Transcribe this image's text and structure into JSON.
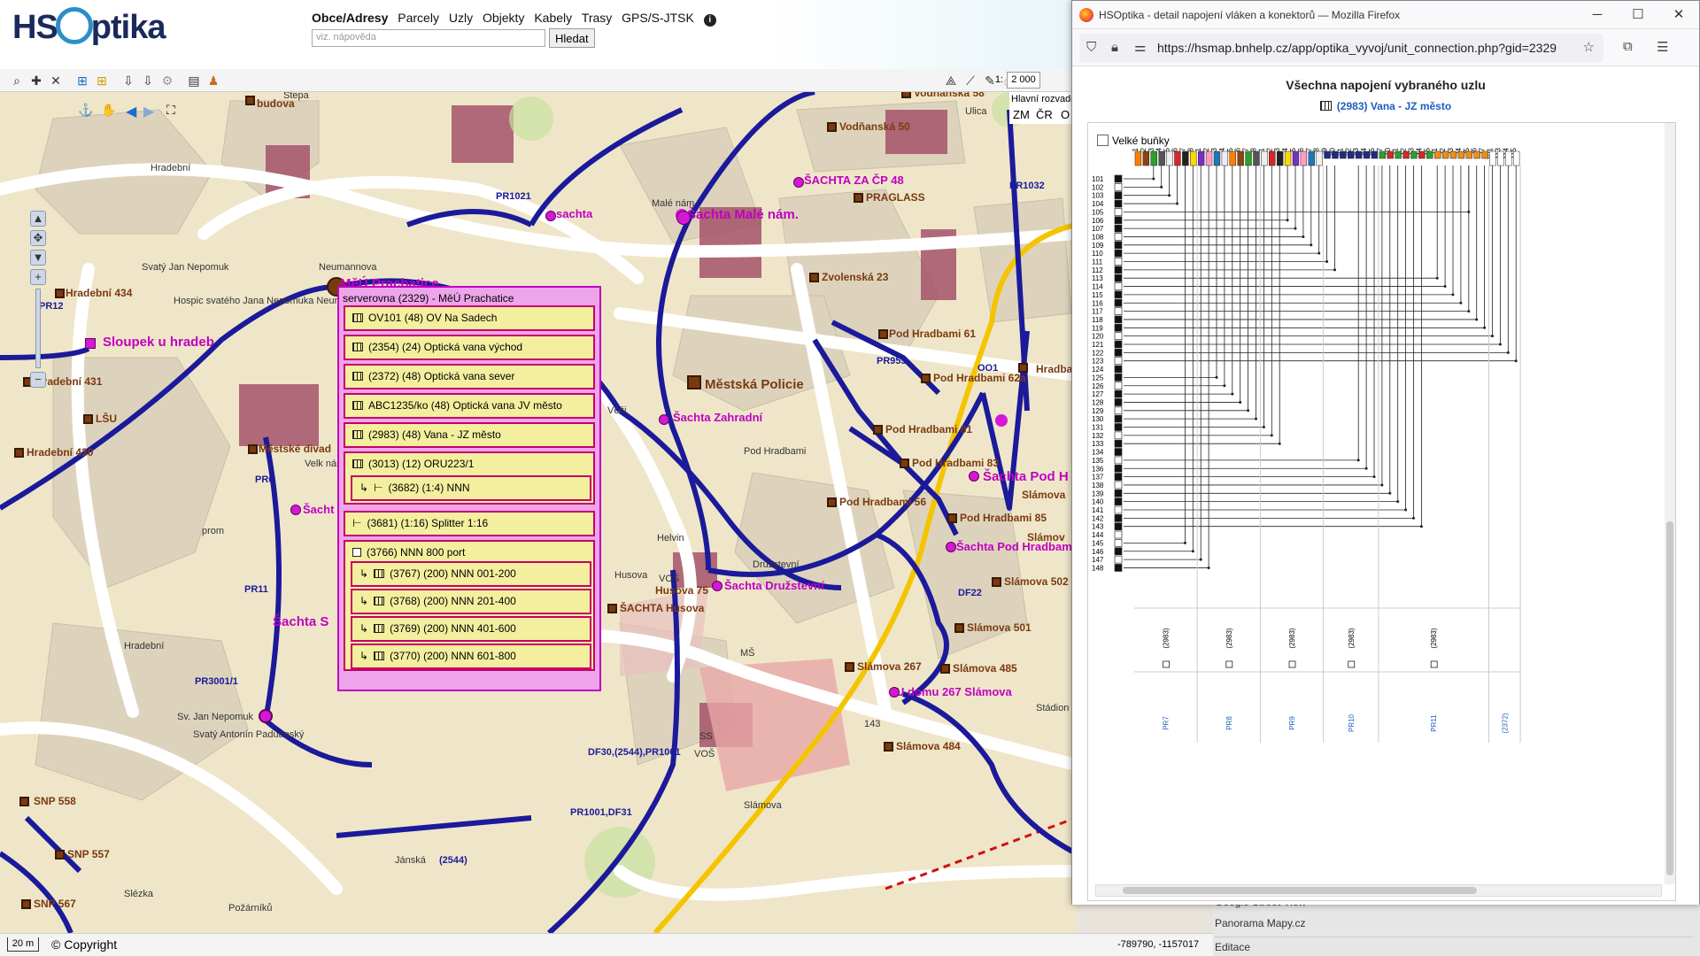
{
  "app": {
    "logo_text_left": "HS",
    "logo_text_right": "ptika",
    "nav": [
      "Obce/Adresy",
      "Parcely",
      "Uzly",
      "Objekty",
      "Kabely",
      "Trasy",
      "GPS/S-JTSK"
    ],
    "search_placeholder": "viz. nápověda",
    "search_button": "Hledat",
    "scale_prefix": "1:",
    "scale_value": "2 000",
    "layer_buttons": [
      "Hlavní rozvaděč",
      "ZM",
      "ČR",
      "O"
    ]
  },
  "map": {
    "labels_brown": [
      "budova",
      "Hradební 434",
      "Hradební 431",
      "Hradební 430",
      "LŠU",
      "Městské divad",
      "Vodňanská 58",
      "Vodňanská 50",
      "PRAGLASS",
      "Zvolenská 23",
      "Pod Hradbami 61",
      "Pod Hradbami 62a",
      "Pod Hradbami 81",
      "Pod Hradbami 83",
      "Pod Hradbami 56",
      "Pod Hradbami 85",
      "Slámova",
      "Slámova 502",
      "Slámova 501",
      "Slámova 267",
      "Slámova 485",
      "Slámova 484",
      "Městská Policie",
      "Hradba",
      "SNP 558",
      "SNP 557",
      "SNP 567",
      "Husova 75",
      "ŠACHTA Husova",
      "Slámov"
    ],
    "labels_pink": [
      "sachta",
      "Šachta Malé nám.",
      "ŠACHTA ZA ČP 48",
      "Sloupek u hradeb",
      "MěÚ Prachatice",
      "Šachta Zahradní",
      "Šachta Pod H",
      "Šachta Pod Hradbam",
      "Šachta Družstevní",
      "U domu 267 Slámova",
      "Šachta S",
      "Šacht"
    ],
    "labels_route": [
      "PR1021",
      "PR1032",
      "PR955",
      "OO1",
      "PR12",
      "PR6",
      "PR11",
      "PR3001/1",
      "DF22",
      "DF30,(2544),PR1001",
      "PR1001,DF31",
      "(2544)",
      "143"
    ],
    "labels_street": [
      "Hradební",
      "Stepa",
      "Neumannova",
      "Svatý Jan Nepomuk",
      "Hospic svatého Jana Nepomuka Neumanna",
      "Malé nám",
      "Věži",
      "Pod Hradbami",
      "Družstevní",
      "Slámova",
      "Husova",
      "Hradební",
      "Sv. Jan Nepomuk",
      "Svatý Antonín Paduánský",
      "Požárníků",
      "Jánská",
      "Slézka",
      "Stádion",
      "Velk náměs",
      "prom",
      "Helvin",
      "MŠ",
      "SS",
      "VOŠ",
      "VOŠ",
      "Ulica"
    ]
  },
  "popup": {
    "title": "serverovna (2329) - MěÚ Prachatice",
    "rows": [
      {
        "icon": "panel-icon",
        "text": "OV101 (48)   OV Na Sadech",
        "indent": false
      },
      {
        "icon": "panel-icon",
        "text": "(2354) (24)   Optická vana východ",
        "indent": false
      },
      {
        "icon": "panel-icon",
        "text": "(2372) (48)   Optická vana sever",
        "indent": false
      },
      {
        "icon": "panel-icon",
        "text": "ABC1235/ko (48)   Optická vana JV město",
        "indent": false
      },
      {
        "icon": "panel-icon",
        "text": "(2983) (48)   Vana - JZ město",
        "indent": false
      },
      {
        "icon": "panel-icon",
        "text": "(3013) (12)   ORU223/1",
        "indent": false
      },
      {
        "icon": "splitter-icon",
        "text": "(3682) (1:4)   NNN",
        "indent": true
      },
      {
        "icon": "splitter-icon",
        "text": "(3681) (1:16)   Splitter 1:16",
        "indent": false
      },
      {
        "icon": "box-icon",
        "text": "(3766)   NNN 800 port",
        "indent": false
      },
      {
        "icon": "panel-icon",
        "text": "(3767) (200)   NNN 001-200",
        "indent": true
      },
      {
        "icon": "panel-icon",
        "text": "(3768) (200)   NNN 201-400",
        "indent": true
      },
      {
        "icon": "panel-icon",
        "text": "(3769) (200)   NNN 401-600",
        "indent": true
      },
      {
        "icon": "panel-icon",
        "text": "(3770) (200)   NNN 601-800",
        "indent": true
      }
    ]
  },
  "status": {
    "scale": "20 m",
    "copyright": "Copyright",
    "coords": "-789790, -1157017"
  },
  "right_panel": {
    "items": [
      "Google Street View",
      "Panorama Mapy.cz",
      "Editace"
    ]
  },
  "firefox": {
    "title": "HSOptika - detail napojení vláken a konektorů — Mozilla Firefox",
    "url": "https://hsmap.bnhelp.cz/app/optika_vyvoj/unit_connection.php?gid=2329",
    "page_title": "Všechna napojení vybraného uzlu",
    "page_subtitle": "(2983) Vana - JZ město",
    "checkbox_label": "Velké buňky",
    "row_labels": [
      "101",
      "102",
      "103",
      "104",
      "105",
      "106",
      "107",
      "108",
      "109",
      "110",
      "111",
      "112",
      "113",
      "114",
      "115",
      "116",
      "117",
      "118",
      "119",
      "120",
      "121",
      "122",
      "123",
      "124",
      "125",
      "126",
      "127",
      "128",
      "129",
      "130",
      "131",
      "132",
      "133",
      "134",
      "135",
      "136",
      "137",
      "138",
      "139",
      "140",
      "141",
      "142",
      "143",
      "144",
      "145",
      "146",
      "147",
      "148"
    ],
    "col_labels": [
      "1",
      "2",
      "3",
      "4",
      "5",
      "6",
      "7",
      "8",
      "1",
      "2",
      "3",
      "4",
      "5",
      "6",
      "7",
      "8",
      "1",
      "2",
      "3",
      "4",
      "5",
      "6",
      "7",
      "8",
      "79",
      "80",
      "81",
      "82",
      "83",
      "84",
      "85",
      "7",
      "10",
      "11",
      "12",
      "13",
      "14",
      "15",
      "21",
      "22",
      "23",
      "24",
      "25",
      "26",
      "27",
      "101",
      "113",
      "114",
      "115"
    ],
    "group_codes": [
      "(2983)",
      "(2983)",
      "(2983)",
      "(2983)",
      "(2983)"
    ],
    "group_routes": [
      "PR7",
      "PR8",
      "PR9",
      "PR10",
      "PR11",
      "(2372)"
    ],
    "colors": {
      "blue": "#1f2a8a",
      "orange": "#f08c1a",
      "line": "#222222",
      "orange_line": "#f0b030"
    }
  }
}
